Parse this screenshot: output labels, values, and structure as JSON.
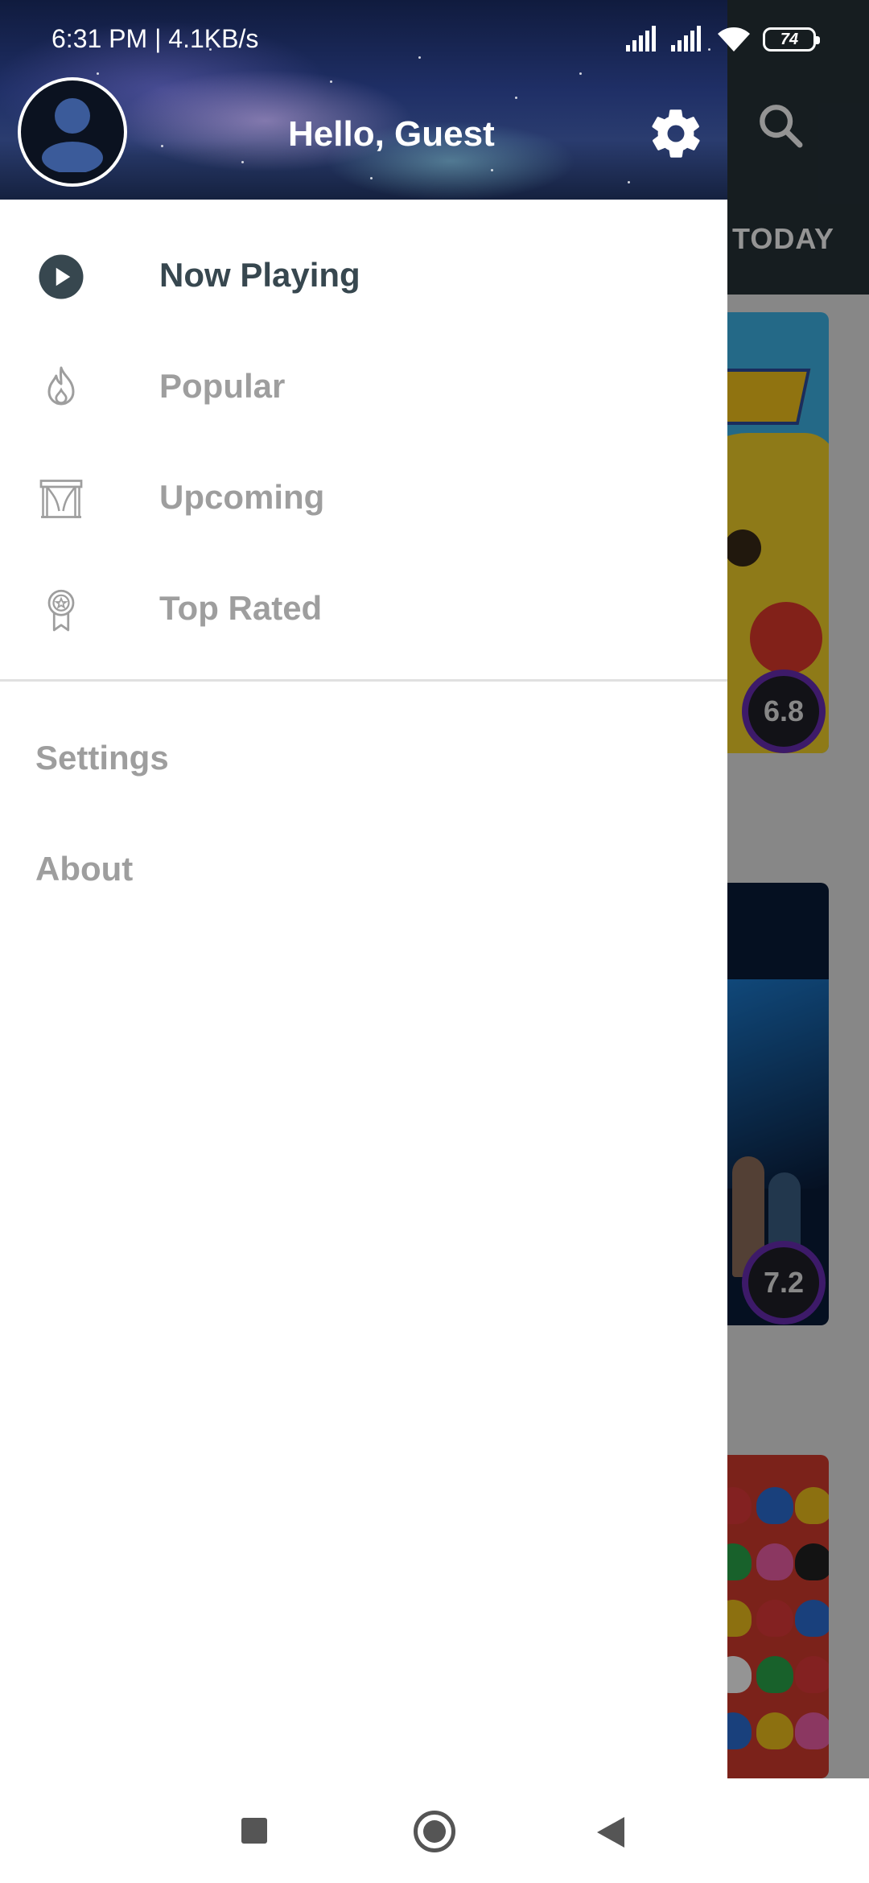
{
  "status_bar": {
    "time_speed": "6:31 PM | 4.1KB/s",
    "battery": "74"
  },
  "drawer": {
    "greeting": "Hello, Guest",
    "menu": [
      {
        "label": "Now Playing",
        "icon": "play-circle-icon",
        "active": true
      },
      {
        "label": "Popular",
        "icon": "flame-icon",
        "active": false
      },
      {
        "label": "Upcoming",
        "icon": "theater-icon",
        "active": false
      },
      {
        "label": "Top Rated",
        "icon": "award-ribbon-icon",
        "active": false
      }
    ],
    "secondary": [
      {
        "label": "Settings"
      },
      {
        "label": "About"
      }
    ]
  },
  "background_app": {
    "tab_label": "TODAY",
    "ratings": [
      "6.8",
      "7.2"
    ]
  },
  "colors": {
    "active_text": "#37474f",
    "inactive_text": "#9e9e9e",
    "toolbar": "#263238",
    "rating_ring": "#6a2db5"
  }
}
